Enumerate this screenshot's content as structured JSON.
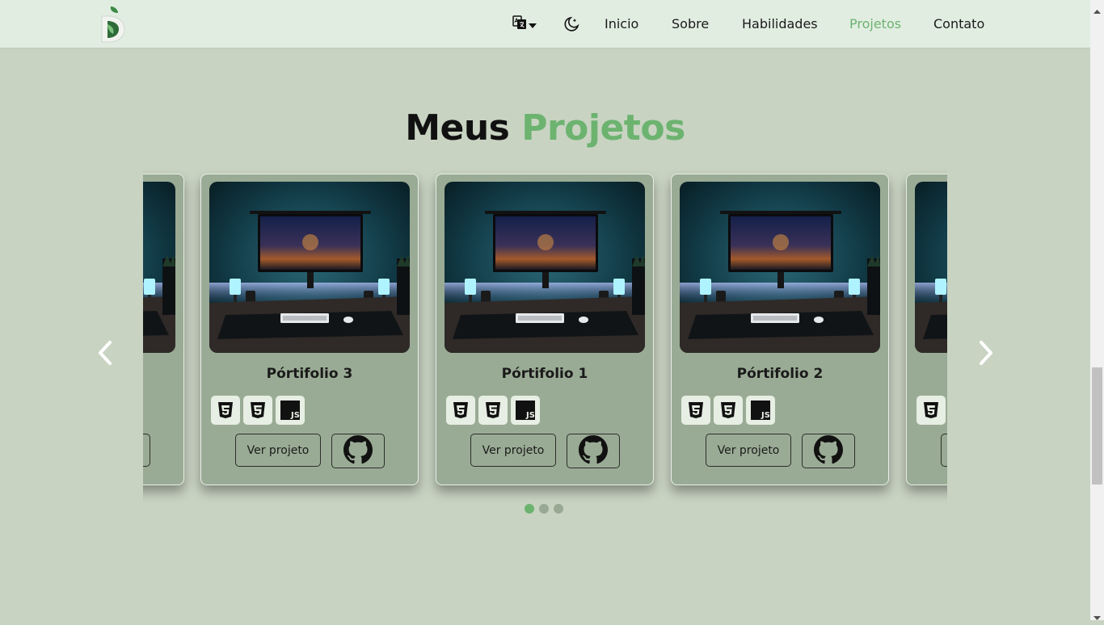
{
  "nav": {
    "links": [
      {
        "label": "Inicio"
      },
      {
        "label": "Sobre"
      },
      {
        "label": "Habilidades"
      },
      {
        "label": "Projetos",
        "active": true
      },
      {
        "label": "Contato"
      }
    ],
    "icons": {
      "logo": "d-leaf-logo",
      "language": "translate-icon",
      "theme": "moon-icon"
    }
  },
  "section": {
    "title_a": "Meus",
    "title_b": "Projetos"
  },
  "projects": [
    {
      "title": "Pórtifolio 3",
      "button": "Ver projeto",
      "techs": [
        "html5-icon",
        "css3-icon",
        "js-icon"
      ],
      "js_label": "JS"
    },
    {
      "title": "Pórtifolio 1",
      "button": "Ver projeto",
      "techs": [
        "html5-icon",
        "css3-icon",
        "js-icon"
      ],
      "js_label": "JS"
    },
    {
      "title": "Pórtifolio 2",
      "button": "Ver projeto",
      "techs": [
        "html5-icon",
        "css3-icon",
        "js-icon"
      ],
      "js_label": "JS"
    }
  ],
  "carousel": {
    "dots": 3,
    "active_dot": 0
  },
  "colors": {
    "accent": "#6cb36f",
    "background": "#c8d3c2",
    "card": "#9aab95",
    "navbar": "#e2ede2"
  }
}
